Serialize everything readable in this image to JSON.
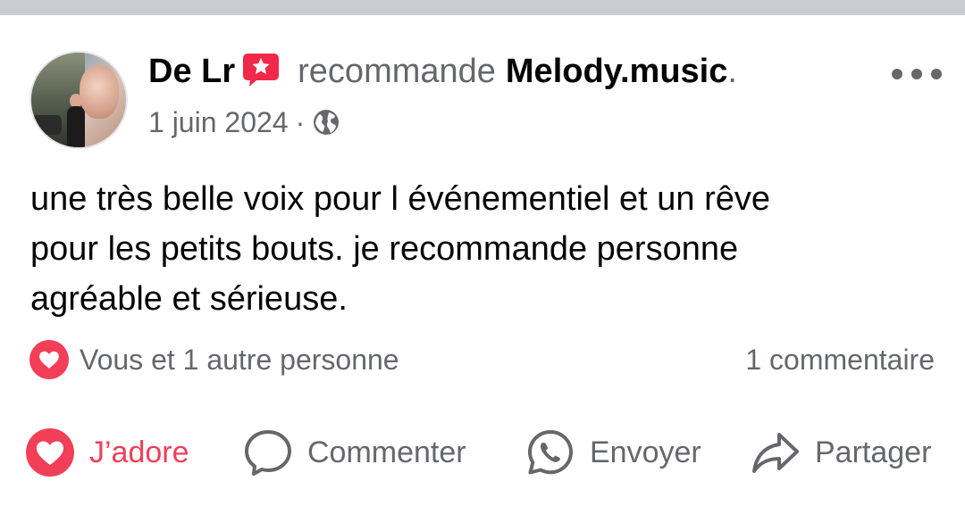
{
  "post": {
    "author": "De Lr",
    "verb": "recommande",
    "page": "Melody.music",
    "page_suffix": ".",
    "date": "1 juin 2024",
    "meta_separator": "·",
    "privacy_icon": "globe-icon",
    "body": "une très belle voix pour l événementiel  et un rêve\npour les petits bouts.  je recommande personne\nagréable  et sérieuse."
  },
  "stats": {
    "reaction_text": "Vous et 1 autre personne",
    "comments": "1 commentaire"
  },
  "actions": {
    "love": "J’adore",
    "comment": "Commenter",
    "send": "Envoyer",
    "share": "Partager"
  },
  "colors": {
    "love_red": "#f33e58",
    "badge_red": "#f02849",
    "secondary_text": "#65676b",
    "top_band": "#c9ccd1"
  }
}
